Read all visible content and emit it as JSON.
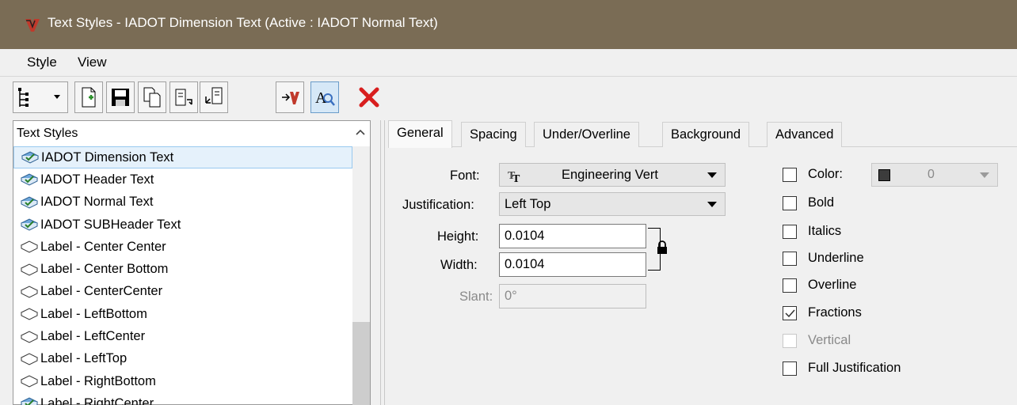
{
  "window": {
    "title": "Text Styles - IADOT Dimension Text (Active : IADOT Normal Text)"
  },
  "menu": [
    {
      "label": "Style"
    },
    {
      "label": "View"
    }
  ],
  "toolbar": {
    "buttons": [
      {
        "icon": "hierarchy-view-icon"
      },
      {
        "icon": "new-style-icon"
      },
      {
        "icon": "save-icon"
      },
      {
        "icon": "copy-style-icon"
      },
      {
        "icon": "export-icon"
      },
      {
        "icon": "import-icon"
      },
      {
        "icon": "activate-icon"
      },
      {
        "icon": "find-text-icon"
      },
      {
        "icon": "delete-icon"
      }
    ]
  },
  "list": {
    "header": "Text Styles",
    "items": [
      {
        "label": "IADOT Dimension Text",
        "type": "library"
      },
      {
        "label": "IADOT Header Text",
        "type": "library"
      },
      {
        "label": "IADOT Normal Text",
        "type": "library"
      },
      {
        "label": "IADOT SUBHeader Text",
        "type": "library"
      },
      {
        "label": "Label - Center  Center",
        "type": "local"
      },
      {
        "label": "Label - Center Bottom",
        "type": "local"
      },
      {
        "label": "Label - CenterCenter",
        "type": "local"
      },
      {
        "label": "Label - LeftBottom",
        "type": "local"
      },
      {
        "label": "Label - LeftCenter",
        "type": "local"
      },
      {
        "label": "Label - LeftTop",
        "type": "local"
      },
      {
        "label": "Label - RightBottom",
        "type": "local"
      },
      {
        "label": "Label - RightCenter",
        "type": "library"
      }
    ]
  },
  "tabs": [
    {
      "label": "General"
    },
    {
      "label": "Spacing"
    },
    {
      "label": "Under/Overline"
    },
    {
      "label": "Background"
    },
    {
      "label": "Advanced"
    }
  ],
  "general": {
    "font_label": "Font:",
    "font_value": "Engineering Vert",
    "justification_label": "Justification:",
    "justification_value": "Left Top",
    "height_label": "Height:",
    "height_value": "0.0104",
    "width_label": "Width:",
    "width_value": "0.0104",
    "slant_label": "Slant:",
    "slant_value": "0°"
  },
  "options": {
    "color_label": "Color:",
    "color_value": "0",
    "color_hex": "#3c3c3c",
    "bold": "Bold",
    "italics": "Italics",
    "underline": "Underline",
    "overline": "Overline",
    "fractions": "Fractions",
    "vertical": "Vertical",
    "full_justification": "Full Justification"
  },
  "colors": {
    "titlebar": "#7a6c55",
    "selected_row": "#e5f1fb",
    "delete_red": "#d81e1e"
  }
}
